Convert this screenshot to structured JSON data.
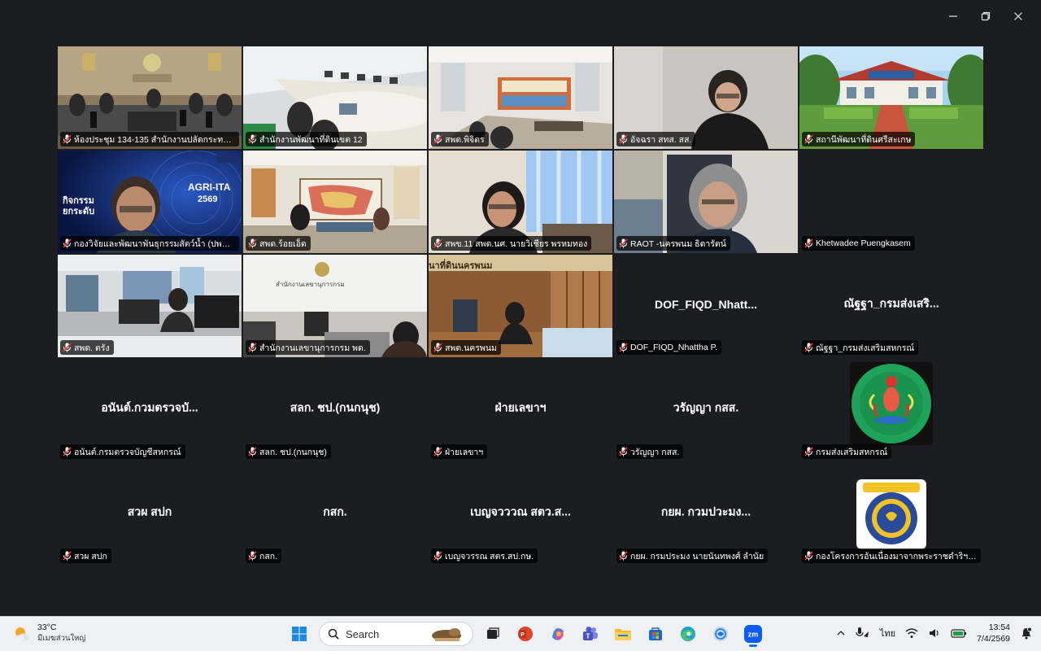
{
  "window": {
    "controls": [
      "minimize",
      "restore",
      "close"
    ]
  },
  "grid": {
    "tiles": [
      {
        "name": "ห้องประชุม 134-135 สำนักงานปลัดกระทรวงเกษ...",
        "type": "video",
        "scene": "conference",
        "active": true
      },
      {
        "name": "สำนักงานพัฒนาที่ดินเขต 12",
        "type": "video",
        "scene": "meeting-room"
      },
      {
        "name": "สพด.พิจิตร",
        "type": "video",
        "scene": "banner-room"
      },
      {
        "name": "อัจฉรา สทส. สส.",
        "type": "video",
        "scene": "person-down"
      },
      {
        "name": "สถานีพัฒนาที่ดินศรีสะเกษ",
        "type": "video",
        "scene": "building"
      },
      {
        "name": "กองวิจัยและพัฒนาพันธุกรรมสัตว์น้ำ (ปพน เร...",
        "type": "video",
        "scene": "ita-poster",
        "poster_title": "AGRI-ITA",
        "poster_year": "2569",
        "poster_left": "กิจกรรม\nยกระดับ"
      },
      {
        "name": "สพด.ร้อยเอ็ด",
        "type": "video",
        "scene": "map-room"
      },
      {
        "name": "สพข.11 สพด.นศ. นายวิเชียร พรหมทอง",
        "type": "video",
        "scene": "woman-curtain"
      },
      {
        "name": "RAOT -นครพนม ธิดารัตน์",
        "type": "video",
        "scene": "woman-grey"
      },
      {
        "name": "Khetwadee Puengkasem",
        "type": "blank"
      },
      {
        "name": "สพด. ตรัง",
        "type": "video",
        "scene": "office-desk"
      },
      {
        "name": "สำนักงานเลขานุการกรม พด.",
        "type": "video",
        "scene": "secretary-office",
        "wall_sign": "สำนักงานเลขานุการกรม"
      },
      {
        "name": "สพด.นครพนม",
        "type": "video",
        "scene": "wood-room",
        "wall_sign": "นาที่ดินนครพนม"
      },
      {
        "name": "DOF_FIQD_Nhattha P.",
        "type": "name",
        "display": "DOF_FIQD_Nhatt..."
      },
      {
        "name": "ณัฐฐา_กรมส่งเสริมสหกรณ์",
        "type": "name",
        "display": "ณัฐฐา_กรมส่งเสริ..."
      },
      {
        "name": "อนันต์.กรมตรวจบัญชีสหกรณ์",
        "type": "name",
        "display": "อนันต์.กวมตรวจบั..."
      },
      {
        "name": "สลก. ชป.(กนกนุช)",
        "type": "name",
        "display": "สลก. ชป.(กนกนุช)"
      },
      {
        "name": "ฝ่ายเลขาฯ",
        "type": "name",
        "display": "ฝ่ายเลขาฯ"
      },
      {
        "name": "วรัญญา กสส.",
        "type": "name",
        "display": "วรัญญา กสส."
      },
      {
        "name": "กรมส่งเสริมสหกรณ์",
        "type": "logo",
        "logo": "green-deity",
        "logo_text": "กรมส่งเสริมสหกรณ์"
      },
      {
        "name": "สวผ สปก",
        "type": "name",
        "display": "สวผ สปก"
      },
      {
        "name": "กสก.",
        "type": "name",
        "display": "กสก."
      },
      {
        "name": "เบญจวรรณ สตร.สป.กษ.",
        "type": "name",
        "display": "เบญจวววณ สตว.ส..."
      },
      {
        "name": "กยผ. กรมประมง นายนันทพงศ์ ลำนัย",
        "type": "name",
        "display": "กยผ. กวมปวะมง..."
      },
      {
        "name": "กองโครงการอันเนื่องมาจากพระราชดำริฯ กรม...",
        "type": "logo",
        "logo": "blue-seal",
        "logo_text": "กรมประมง"
      }
    ]
  },
  "taskbar": {
    "weather": {
      "temp": "33°C",
      "condition": "มีเมฆส่วนใหญ่"
    },
    "search_label": "Search",
    "apps": [
      "windows-start",
      "search",
      "task-view",
      "office",
      "copilot",
      "teams",
      "file-explorer",
      "store",
      "edge",
      "app",
      "zoom"
    ],
    "active_app": "zoom",
    "language": "ไทย",
    "time": "13:54",
    "date": "7/4/2569"
  }
}
